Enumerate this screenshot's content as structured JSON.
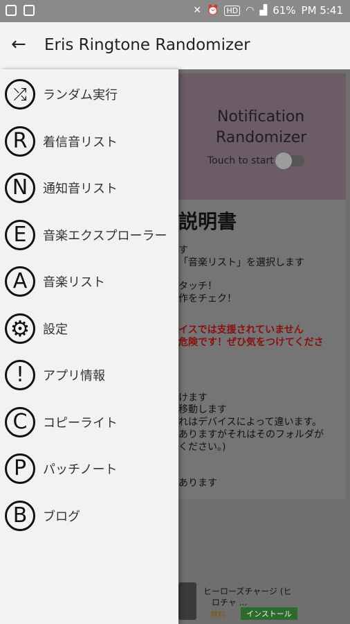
{
  "status": {
    "battery": "61%",
    "time": "PM 5:41",
    "hd": "HD"
  },
  "appbar": {
    "title": "Eris Ringtone Randomizer",
    "back_icon": "←"
  },
  "drawer": {
    "items": [
      {
        "icon": "⤮",
        "label": "ランダム実行"
      },
      {
        "icon": "R",
        "label": "着信音リスト"
      },
      {
        "icon": "N",
        "label": "通知音リスト"
      },
      {
        "icon": "E",
        "label": "音楽エクスプローラー"
      },
      {
        "icon": "A",
        "label": "音楽リスト"
      },
      {
        "icon": "⚙",
        "label": "設定"
      },
      {
        "icon": "!",
        "label": "アプリ情報"
      },
      {
        "icon": "C",
        "label": "コピーライト"
      },
      {
        "icon": "P",
        "label": "パッチノート"
      },
      {
        "icon": "B",
        "label": "ブログ"
      }
    ]
  },
  "card": {
    "title_line1": "Notification",
    "title_line2": "Randomizer",
    "touch": "Touch to start"
  },
  "manual": {
    "heading": "説明書",
    "lines": [
      "す",
      "「音楽リスト」を選択します",
      "タッチ！",
      "作をチェク！",
      "イスでは支援されていません",
      "危険です！ぜひ気をつけてくださ",
      "けます",
      "移動します",
      "れはデバイスによって違います。",
      "ありますがそれはそのフォルダが",
      "ください。)",
      "あります"
    ]
  },
  "ad": {
    "name_line1": "ヒーローズチャージ (ヒ",
    "name_line2": "ロチャ ...",
    "free": "無料",
    "install": "インストール"
  }
}
